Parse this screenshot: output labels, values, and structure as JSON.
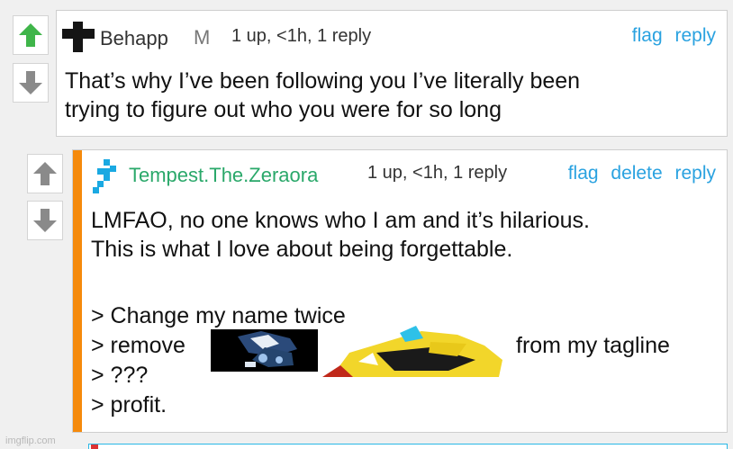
{
  "comment1": {
    "username": "Behapp",
    "badge": "M",
    "meta": "1 up, <1h, 1 reply",
    "actions": {
      "flag": "flag",
      "reply": "reply"
    },
    "body": "That’s why I’ve been following you I’ve literally been\ntrying to figure out who you were for so long",
    "avatar_icon": "black-cross-icon",
    "upvote_icon": "green-up-arrow-icon",
    "downvote_icon": "grey-down-arrow-icon"
  },
  "comment2": {
    "username": "Tempest.The.Zeraora",
    "meta": "1 up, <1h, 1 reply",
    "actions": {
      "flag": "flag",
      "delete": "delete",
      "reply": "reply"
    },
    "body_intro": "LMFAO, no one knows who I am and it’s hilarious.\nThis is what I love about being forgettable.",
    "list": {
      "line1": "> Change my name twice",
      "line2_pre": "> remove",
      "line2_post": "from my tagline",
      "line3": "> ???",
      "line4": "> profit."
    },
    "avatar_icon": "blue-cross-icon",
    "accent_color": "#f58a0c",
    "username_color": "#2aa86a"
  },
  "watermark": "imgflip.com",
  "colors": {
    "link": "#2aa2e0",
    "upvote": "#3fb54a",
    "arrow_grey": "#8a8a8a"
  }
}
